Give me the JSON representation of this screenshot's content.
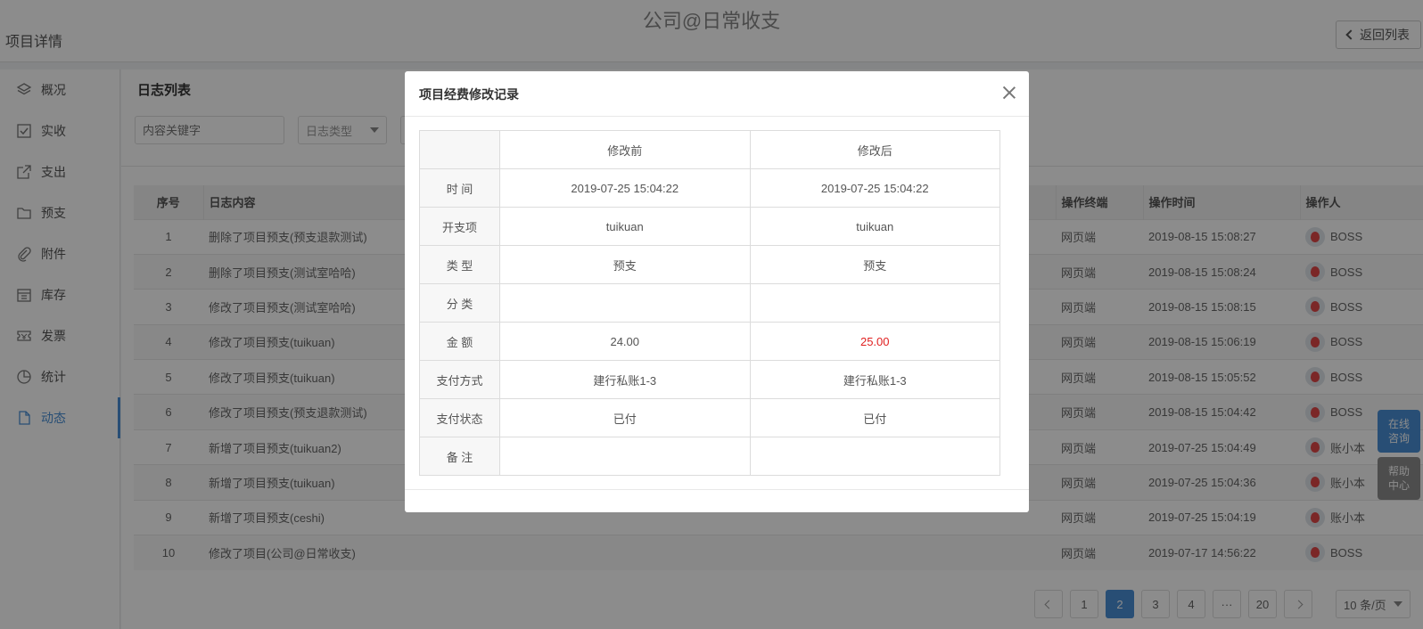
{
  "header": {
    "app_title": "公司@日常收支",
    "page_title": "项目详情",
    "back_label": "返回列表"
  },
  "sidebar": {
    "items": [
      {
        "label": "概况",
        "icon": "layers-icon"
      },
      {
        "label": "实收",
        "icon": "checkbox-icon"
      },
      {
        "label": "支出",
        "icon": "external-link-icon"
      },
      {
        "label": "预支",
        "icon": "folder-icon"
      },
      {
        "label": "附件",
        "icon": "paperclip-icon"
      },
      {
        "label": "库存",
        "icon": "warehouse-icon"
      },
      {
        "label": "发票",
        "icon": "ticket-icon"
      },
      {
        "label": "统计",
        "icon": "pie-chart-icon"
      },
      {
        "label": "动态",
        "icon": "file-icon"
      }
    ],
    "active": "动态"
  },
  "main": {
    "section_title": "日志列表",
    "filter": {
      "keyword_placeholder": "内容关键字",
      "type_placeholder": "日志类型"
    },
    "table": {
      "headers": {
        "seq": "序号",
        "content": "日志内容",
        "terminal": "操作终端",
        "time": "操作时间",
        "operator": "操作人"
      },
      "rows": [
        {
          "seq": "1",
          "content": "删除了项目预支(预支退款测试)",
          "terminal": "网页端",
          "time": "2019-08-15 15:08:27",
          "operator": "BOSS"
        },
        {
          "seq": "2",
          "content": "删除了项目预支(测试室哈哈)",
          "terminal": "网页端",
          "time": "2019-08-15 15:08:24",
          "operator": "BOSS"
        },
        {
          "seq": "3",
          "content": "修改了项目预支(测试室哈哈)",
          "terminal": "网页端",
          "time": "2019-08-15 15:08:15",
          "operator": "BOSS"
        },
        {
          "seq": "4",
          "content": "修改了项目预支(tuikuan)",
          "terminal": "网页端",
          "time": "2019-08-15 15:06:19",
          "operator": "BOSS"
        },
        {
          "seq": "5",
          "content": "修改了项目预支(tuikuan)",
          "terminal": "网页端",
          "time": "2019-08-15 15:05:52",
          "operator": "BOSS"
        },
        {
          "seq": "6",
          "content": "修改了项目预支(预支退款测试)",
          "terminal": "网页端",
          "time": "2019-08-15 15:04:42",
          "operator": "BOSS"
        },
        {
          "seq": "7",
          "content": "新增了项目预支(tuikuan2)",
          "terminal": "网页端",
          "time": "2019-07-25 15:04:49",
          "operator": "账小本"
        },
        {
          "seq": "8",
          "content": "新增了项目预支(tuikuan)",
          "terminal": "网页端",
          "time": "2019-07-25 15:04:36",
          "operator": "账小本"
        },
        {
          "seq": "9",
          "content": "新增了项目预支(ceshi)",
          "terminal": "网页端",
          "time": "2019-07-25 15:04:19",
          "operator": "账小本"
        },
        {
          "seq": "10",
          "content": "修改了项目(公司@日常收支)",
          "terminal": "网页端",
          "time": "2019-07-17 14:56:22",
          "operator": "BOSS"
        }
      ]
    },
    "pagination": {
      "pages": [
        "1",
        "2",
        "3",
        "4",
        "···",
        "20"
      ],
      "current": "2",
      "page_size": "10 条/页"
    }
  },
  "float": {
    "online": "在线咨询",
    "help": "帮助中心"
  },
  "modal": {
    "title": "项目经费修改记录",
    "col_before": "修改前",
    "col_after": "修改后",
    "rows": [
      {
        "label": "时 间",
        "before": "2019-07-25 15:04:22",
        "after": "2019-07-25 15:04:22"
      },
      {
        "label": "开支项",
        "before": "tuikuan",
        "after": "tuikuan"
      },
      {
        "label": "类 型",
        "before": "预支",
        "after": "预支"
      },
      {
        "label": "分 类",
        "before": "",
        "after": ""
      },
      {
        "label": "金 额",
        "before": "24.00",
        "after": "25.00"
      },
      {
        "label": "支付方式",
        "before": "建行私账1-3",
        "after": "建行私账1-3"
      },
      {
        "label": "支付状态",
        "before": "已付",
        "after": "已付"
      },
      {
        "label": "备 注",
        "before": "",
        "after": ""
      }
    ],
    "changed_color": "#e02020"
  },
  "colors": {
    "accent": "#4a8fd6",
    "help_bg": "#8d8d8d"
  }
}
